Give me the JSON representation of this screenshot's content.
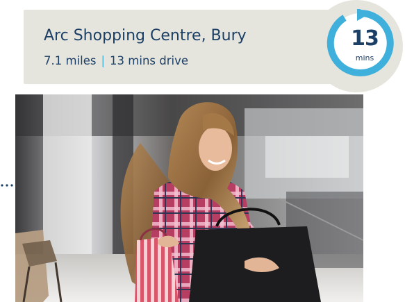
{
  "location": {
    "name": "Arc Shopping Centre, Bury",
    "distance": "7.1 miles",
    "separator": "|",
    "drive_time": "13 mins drive"
  },
  "badge": {
    "minutes": "13",
    "unit": "mins",
    "icon": "clock-arrow-icon",
    "ring_color": "#3fb0dc",
    "text_color": "#1c3f66"
  },
  "photo": {
    "subject": "woman-with-shopping-bags-image"
  },
  "colors": {
    "card_background": "#e6e5dd",
    "accent": "#3fb0dc",
    "heading": "#1c3f66"
  }
}
